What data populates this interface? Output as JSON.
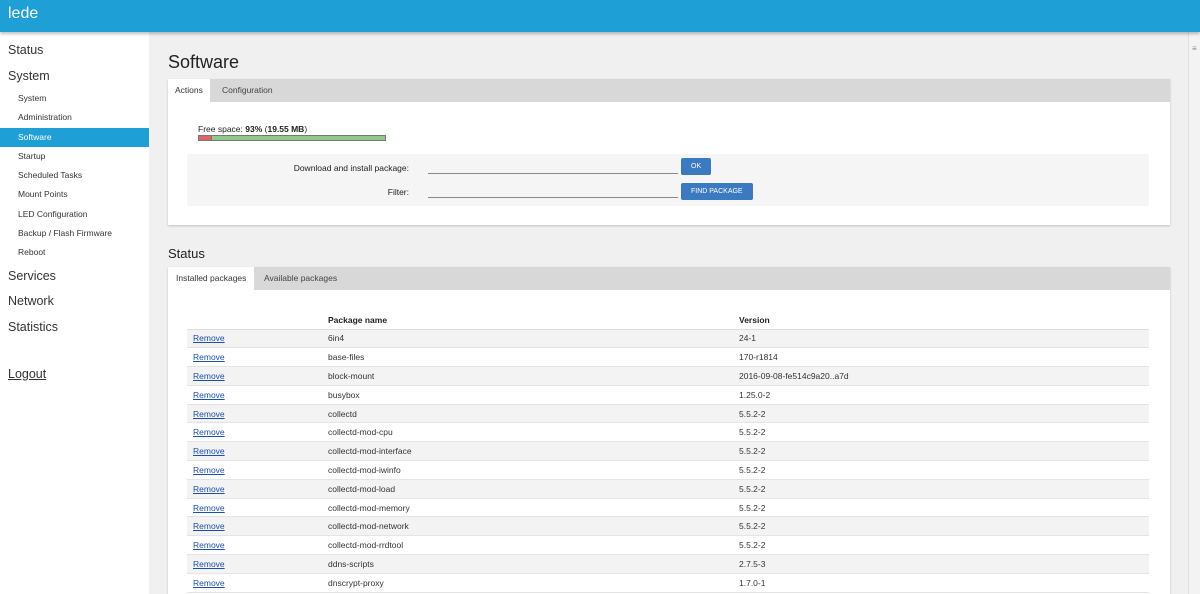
{
  "header": {
    "brand": "lede"
  },
  "sidebar": {
    "status": "Status",
    "system": "System",
    "system_items": [
      "System",
      "Administration",
      "Software",
      "Startup",
      "Scheduled Tasks",
      "Mount Points",
      "LED Configuration",
      "Backup / Flash Firmware",
      "Reboot"
    ],
    "active_item": "Software",
    "services": "Services",
    "network": "Network",
    "statistics": "Statistics",
    "logout": "Logout"
  },
  "page": {
    "title": "Software",
    "actions_tabs": {
      "actions": "Actions",
      "configuration": "Configuration"
    },
    "free_space": {
      "label": "Free space: ",
      "percent": "93%",
      "size": "19.55 MB",
      "used_fraction": 0.07
    },
    "download": {
      "label": "Download and install package:",
      "value": "",
      "button": "OK"
    },
    "filter": {
      "label": "Filter:",
      "value": "",
      "button": "FIND PACKAGE"
    },
    "status_title": "Status",
    "status_tabs": {
      "installed": "Installed packages",
      "available": "Available packages"
    },
    "table": {
      "headers": {
        "action": "",
        "name": "Package name",
        "version": "Version"
      },
      "remove_label": "Remove",
      "rows": [
        {
          "name": "6in4",
          "version": "24-1"
        },
        {
          "name": "base-files",
          "version": "170-r1814"
        },
        {
          "name": "block-mount",
          "version": "2016-09-08-fe514c9a20..a7d"
        },
        {
          "name": "busybox",
          "version": "1.25.0-2"
        },
        {
          "name": "collectd",
          "version": "5.5.2-2"
        },
        {
          "name": "collectd-mod-cpu",
          "version": "5.5.2-2"
        },
        {
          "name": "collectd-mod-interface",
          "version": "5.5.2-2"
        },
        {
          "name": "collectd-mod-iwinfo",
          "version": "5.5.2-2"
        },
        {
          "name": "collectd-mod-load",
          "version": "5.5.2-2"
        },
        {
          "name": "collectd-mod-memory",
          "version": "5.5.2-2"
        },
        {
          "name": "collectd-mod-network",
          "version": "5.5.2-2"
        },
        {
          "name": "collectd-mod-rrdtool",
          "version": "5.5.2-2"
        },
        {
          "name": "ddns-scripts",
          "version": "2.7.5-3"
        },
        {
          "name": "dnscrypt-proxy",
          "version": "1.7.0-1"
        }
      ]
    }
  },
  "colors": {
    "accent": "#1e9fd6",
    "button": "#3a7ac0",
    "used": "#e06464",
    "free": "#90c88a"
  }
}
